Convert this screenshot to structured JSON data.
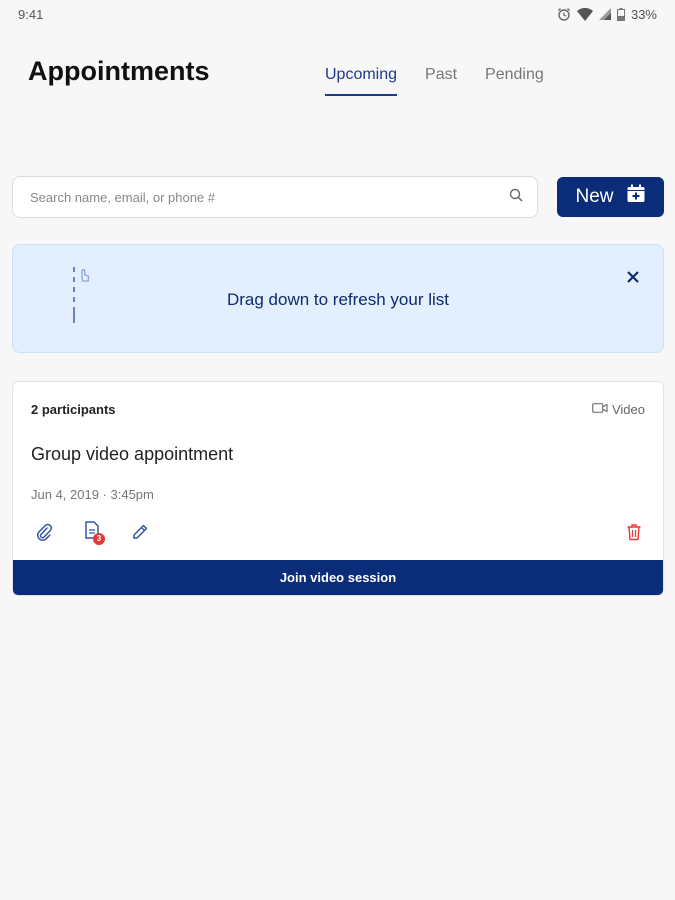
{
  "status_bar": {
    "time": "9:41",
    "battery": "33%"
  },
  "header": {
    "title": "Appointments",
    "tabs": [
      {
        "label": "Upcoming",
        "active": true
      },
      {
        "label": "Past",
        "active": false
      },
      {
        "label": "Pending",
        "active": false
      }
    ]
  },
  "search": {
    "placeholder": "Search name, email, or phone #",
    "value": "",
    "icon": "search-icon"
  },
  "new_button": {
    "label": "New",
    "icon": "calendar-add-icon"
  },
  "banner": {
    "text": "Drag down to refresh your list",
    "close_icon": "close-icon",
    "gesture_icon": "drag-down-gesture-icon"
  },
  "appointment": {
    "participants": "2 participants",
    "type_label": "Video",
    "title": "Group video appointment",
    "datetime": "Jun 4, 2019 · 3:45pm",
    "document_count": "3",
    "join_label": "Join video session"
  },
  "colors": {
    "primary": "#0b2c78",
    "banner_bg": "#e3efff",
    "tab_active": "#1f3a8a",
    "delete": "#e53935"
  }
}
